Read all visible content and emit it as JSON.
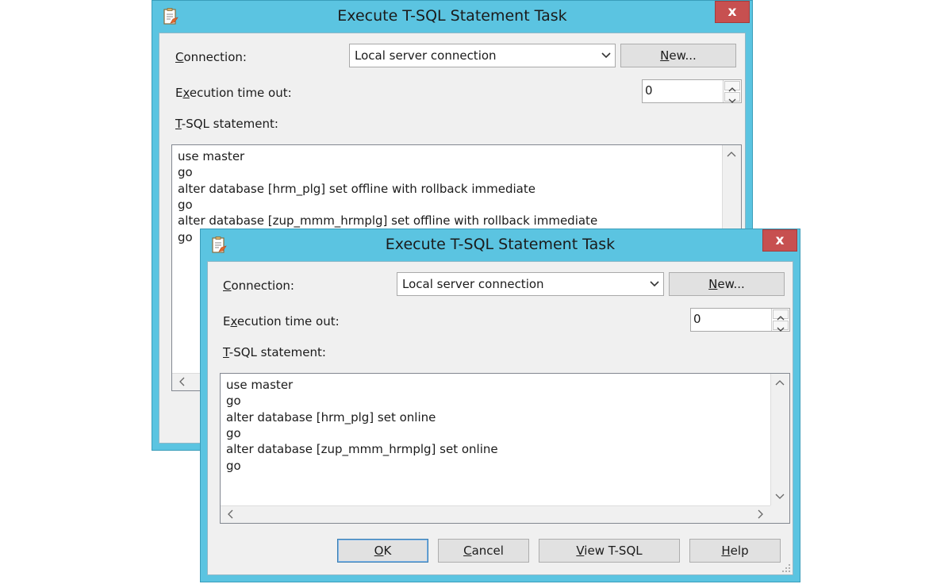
{
  "dialogs": [
    {
      "title": "Execute T-SQL Statement Task",
      "close_label": "x",
      "connection_label_u": "C",
      "connection_label_rest": "onnection:",
      "connection_value": "Local server connection",
      "new_button_u": "N",
      "new_button_rest": "ew...",
      "timeout_label_pre": "E",
      "timeout_label_u": "x",
      "timeout_label_rest": "ecution time out:",
      "timeout_value": "0",
      "statement_label_u": "T",
      "statement_label_rest": "-SQL statement:",
      "statement_lines": [
        "use master",
        "go",
        "alter database [hrm_plg] set offline with rollback immediate",
        "go",
        "alter database [zup_mmm_hrmplg] set offline with rollback immediate",
        "go"
      ]
    },
    {
      "title": "Execute T-SQL Statement Task",
      "close_label": "x",
      "connection_label_u": "C",
      "connection_label_rest": "onnection:",
      "connection_value": "Local server connection",
      "new_button_u": "N",
      "new_button_rest": "ew...",
      "timeout_label_pre": "E",
      "timeout_label_u": "x",
      "timeout_label_rest": "ecution time out:",
      "timeout_value": "0",
      "statement_label_u": "T",
      "statement_label_rest": "-SQL statement:",
      "statement_lines": [
        "use master",
        "go",
        "alter database [hrm_plg] set online",
        "go",
        "alter database [zup_mmm_hrmplg] set online",
        "go"
      ],
      "buttons": {
        "ok_u": "O",
        "ok_rest": "K",
        "cancel_pre": "",
        "cancel_u": "C",
        "cancel_rest": "ancel",
        "view_pre": "",
        "view_u": "V",
        "view_rest": "iew T-SQL",
        "help_u": "H",
        "help_rest": "elp"
      }
    }
  ],
  "colors": {
    "title_bar": "#5bc4e1",
    "close_button": "#c75050",
    "client_background": "#f0f0f0"
  },
  "icons": [
    "task-icon",
    "close-icon",
    "dropdown-arrow-icon",
    "spin-up-icon",
    "spin-down-icon",
    "scroll-up-icon",
    "scroll-down-icon",
    "scroll-left-icon",
    "scroll-right-icon",
    "resize-grip-icon"
  ]
}
